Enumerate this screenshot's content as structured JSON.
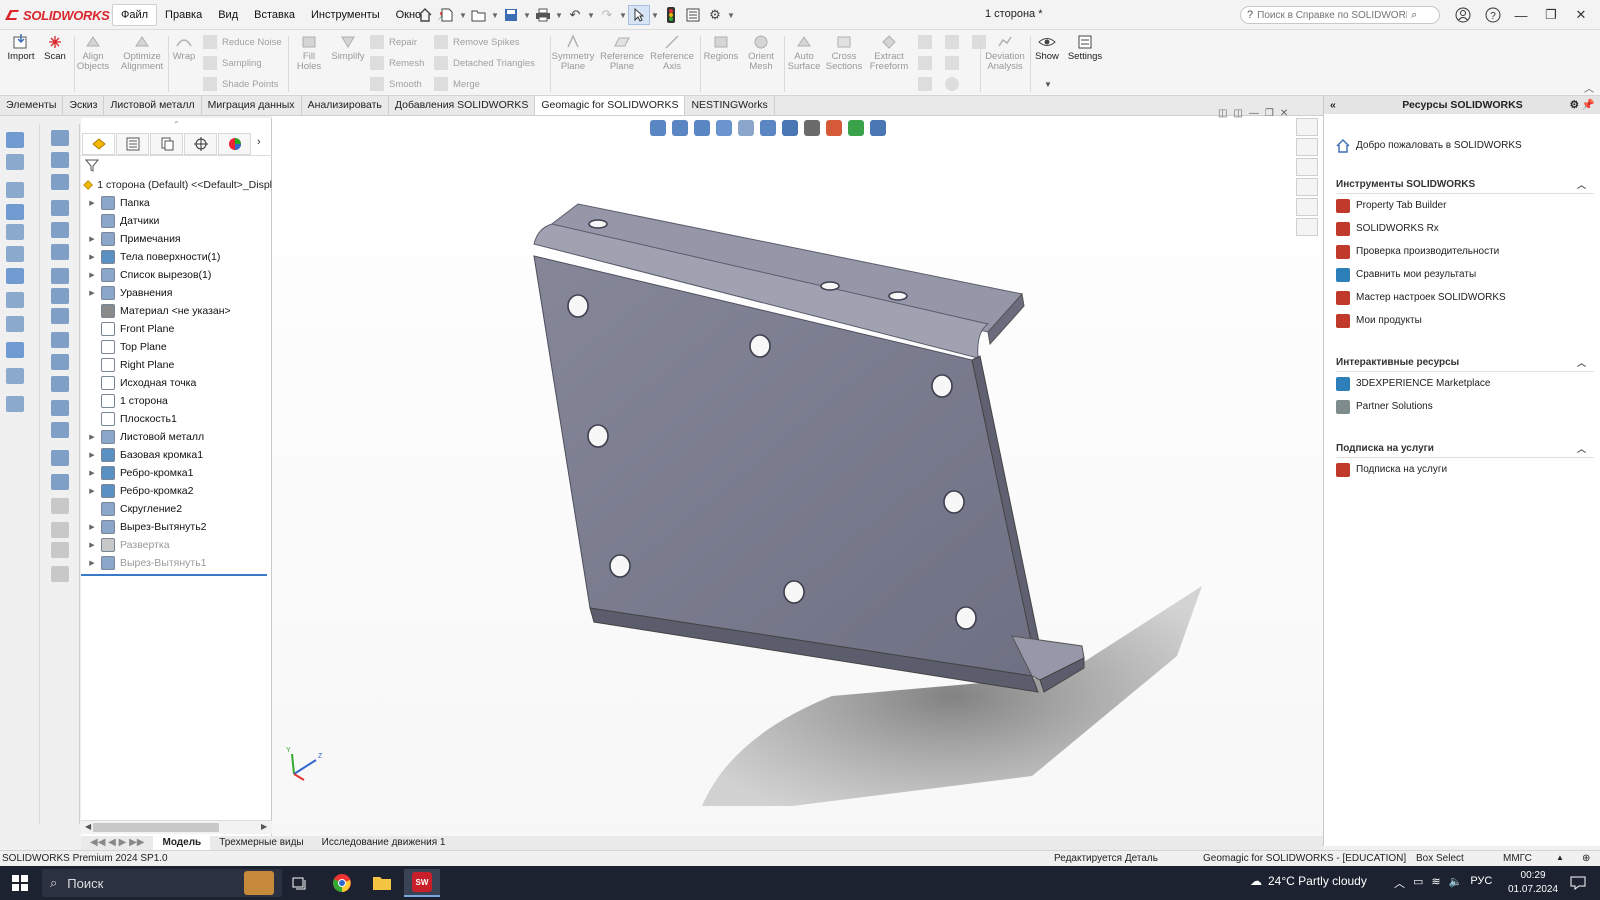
{
  "app": {
    "brand": "SOLIDWORKS",
    "document_title": "1 сторона *"
  },
  "menu": [
    "Файл",
    "Правка",
    "Вид",
    "Вставка",
    "Инструменты",
    "Окно"
  ],
  "help_search": {
    "placeholder": "Поиск в Справке по SOLIDWORKS"
  },
  "toolbar": {
    "import": "Import",
    "scan": "Scan",
    "align_objects": [
      "Align",
      "Objects"
    ],
    "optimize_alignment": [
      "Optimize",
      "Alignment"
    ],
    "wrap": "Wrap",
    "reduce_noise": "Reduce Noise",
    "sampling": "Sampling",
    "shade_points": "Shade Points",
    "fill_holes": [
      "Fill",
      "Holes"
    ],
    "simplify": "Simplify",
    "repair": "Repair",
    "remesh": "Remesh",
    "smooth": "Smooth",
    "remove_spikes": "Remove Spikes",
    "detached_triangles": "Detached Triangles",
    "merge": "Merge",
    "symmetry_plane": [
      "Symmetry",
      "Plane"
    ],
    "reference_plane": [
      "Reference",
      "Plane"
    ],
    "reference_axis": [
      "Reference",
      "Axis"
    ],
    "regions": "Regions",
    "orient_mesh": [
      "Orient",
      "Mesh"
    ],
    "auto_surface": [
      "Auto",
      "Surface"
    ],
    "cross_sections": [
      "Cross",
      "Sections"
    ],
    "extract_freeform": [
      "Extract",
      "Freeform"
    ],
    "deviation_analysis": [
      "Deviation",
      "Analysis"
    ],
    "show": "Show",
    "settings": "Settings"
  },
  "command_tabs": [
    "Элементы",
    "Эскиз",
    "Листовой металл",
    "Миграция данных",
    "Анализировать",
    "Добавления SOLIDWORKS",
    "Geomagic for SOLIDWORKS",
    "NESTINGWorks"
  ],
  "active_command_tab": "Geomagic for SOLIDWORKS",
  "feature_tree": {
    "root": "1 сторона (Default) <<Default>_Displ",
    "items": [
      {
        "label": "Папка",
        "expandable": true,
        "dim": false,
        "icon": "folder-icon"
      },
      {
        "label": "Датчики",
        "expandable": false,
        "dim": false,
        "icon": "sensor-icon"
      },
      {
        "label": "Примечания",
        "expandable": true,
        "dim": false,
        "icon": "annotation-icon"
      },
      {
        "label": "Тела поверхности(1)",
        "expandable": true,
        "dim": false,
        "icon": "surface-body-icon"
      },
      {
        "label": "Список вырезов(1)",
        "expandable": true,
        "dim": false,
        "icon": "cut-list-icon"
      },
      {
        "label": "Уравнения",
        "expandable": true,
        "dim": false,
        "icon": "equation-icon"
      },
      {
        "label": "Материал <не указан>",
        "expandable": false,
        "dim": false,
        "icon": "material-icon"
      },
      {
        "label": "Front Plane",
        "expandable": false,
        "dim": false,
        "icon": "plane-icon"
      },
      {
        "label": "Top Plane",
        "expandable": false,
        "dim": false,
        "icon": "plane-icon"
      },
      {
        "label": "Right Plane",
        "expandable": false,
        "dim": false,
        "icon": "plane-icon"
      },
      {
        "label": "Исходная точка",
        "expandable": false,
        "dim": false,
        "icon": "origin-icon"
      },
      {
        "label": "1 сторона",
        "expandable": false,
        "dim": false,
        "icon": "mesh-icon"
      },
      {
        "label": "Плоскость1",
        "expandable": false,
        "dim": false,
        "icon": "plane-icon"
      },
      {
        "label": "Листовой металл",
        "expandable": true,
        "dim": false,
        "icon": "sheet-metal-icon"
      },
      {
        "label": "Базовая кромка1",
        "expandable": true,
        "dim": false,
        "icon": "base-flange-icon"
      },
      {
        "label": "Ребро-кромка1",
        "expandable": true,
        "dim": false,
        "icon": "edge-flange-icon"
      },
      {
        "label": "Ребро-кромка2",
        "expandable": true,
        "dim": false,
        "icon": "edge-flange-icon"
      },
      {
        "label": "Скругление2",
        "expandable": false,
        "dim": false,
        "icon": "fillet-icon"
      },
      {
        "label": "Вырез-Вытянуть2",
        "expandable": true,
        "dim": false,
        "icon": "cut-extrude-icon"
      },
      {
        "label": "Развертка",
        "expandable": true,
        "dim": true,
        "icon": "flat-pattern-icon"
      },
      {
        "label": "Вырез-Вытянуть1",
        "expandable": true,
        "dim": true,
        "icon": "cut-extrude-icon"
      }
    ]
  },
  "task_pane": {
    "title": "Ресурсы SOLIDWORKS",
    "welcome": "Добро пожаловать в SOLIDWORKS",
    "sections": [
      {
        "title": "Инструменты SOLIDWORKS",
        "links": [
          "Property Tab Builder",
          "SOLIDWORKS Rx",
          "Проверка производительности",
          "Сравнить мои результаты",
          "Мастер настроек SOLIDWORKS",
          "Мои продукты"
        ]
      },
      {
        "title": "Интерактивные ресурсы",
        "links": [
          "3DEXPERIENCE Marketplace",
          "Partner Solutions"
        ]
      },
      {
        "title": "Подписка на услуги",
        "links": [
          "Подписка на услуги"
        ]
      }
    ]
  },
  "bottom_tabs": [
    "Модель",
    "Трехмерные виды",
    "Исследование движения 1"
  ],
  "status": {
    "version": "SOLIDWORKS Premium 2024 SP1.0",
    "editing": "Редактируется Деталь",
    "addin": "Geomagic for SOLIDWORKS - [EDUCATION]",
    "select_mode": "Box Select",
    "units": "ММГС"
  },
  "taskbar": {
    "search": "Поиск",
    "weather": "24°C  Partly cloudy",
    "lang": "РУС",
    "time": "00:29",
    "date": "01.07.2024"
  },
  "colors": {
    "brand_red": "#d8262c",
    "part_fill": "#7d7f94",
    "active_tab_bg": "#ffffff"
  }
}
